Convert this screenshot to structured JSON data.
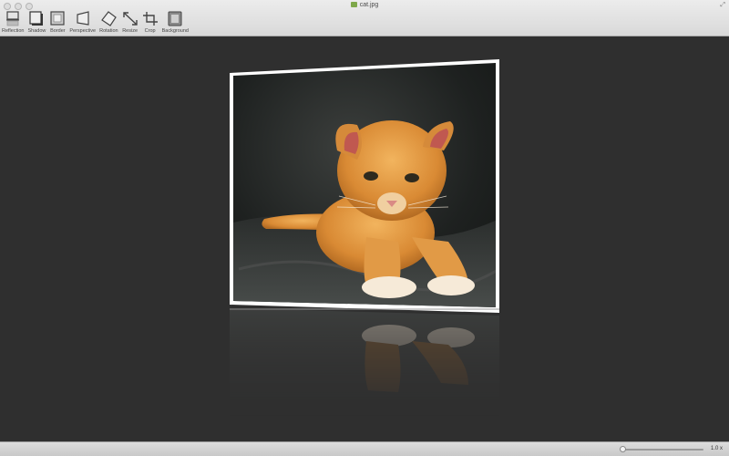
{
  "window": {
    "title": "cat.jpg"
  },
  "toolbar": {
    "tools": [
      {
        "label": "Reflection",
        "icon": "reflection-icon"
      },
      {
        "label": "Shadow",
        "icon": "shadow-icon"
      },
      {
        "label": "Border",
        "icon": "border-icon"
      },
      {
        "label": "Perspective",
        "icon": "perspective-icon"
      },
      {
        "label": "Rotation",
        "icon": "rotation-icon"
      },
      {
        "label": "Resize",
        "icon": "resize-icon"
      },
      {
        "label": "Crop",
        "icon": "crop-icon"
      },
      {
        "label": "Background",
        "icon": "background-icon"
      }
    ]
  },
  "canvas": {
    "background": "#2f2f2f",
    "frame_color": "#ffffff"
  },
  "statusbar": {
    "zoom_label": "1.0 x",
    "zoom_level": 0.0
  }
}
